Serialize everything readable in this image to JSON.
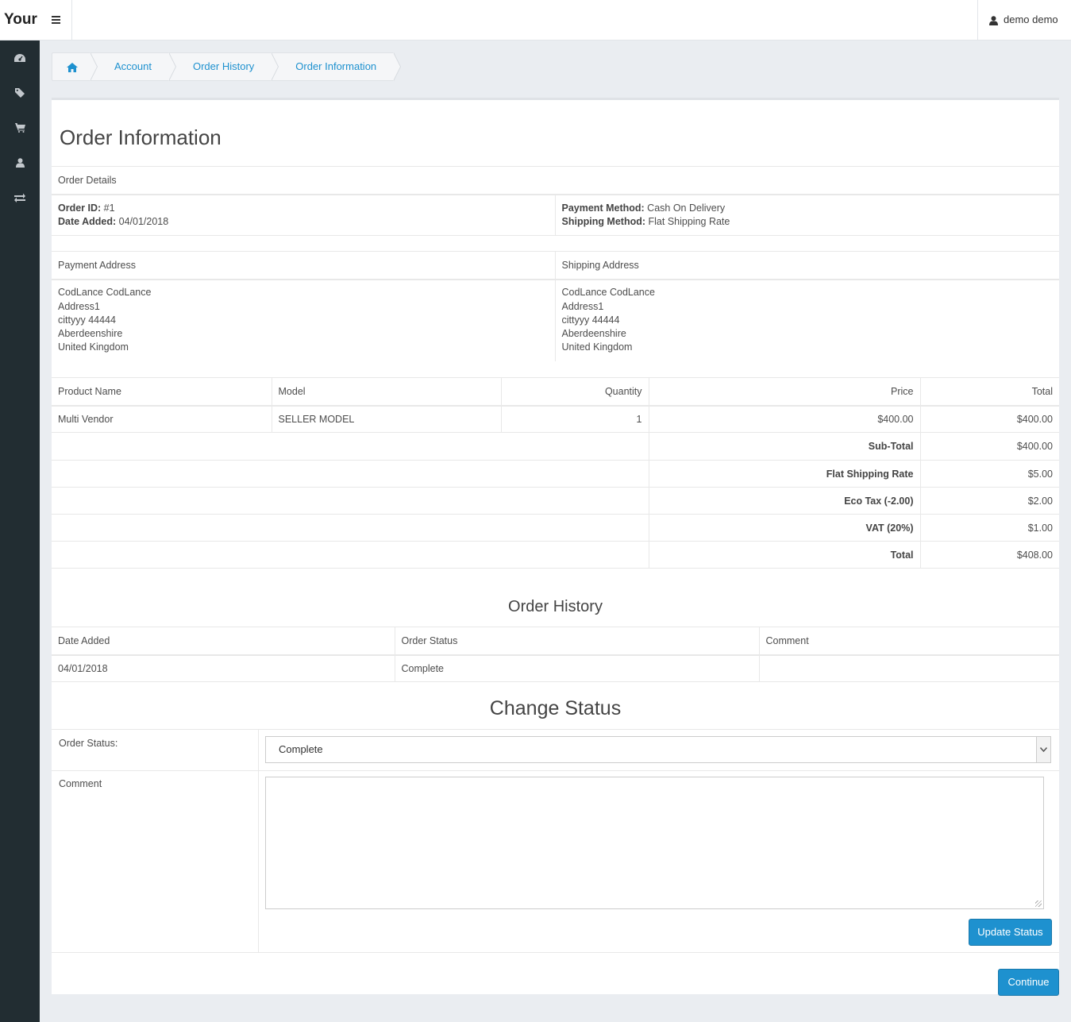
{
  "header": {
    "brand": "Your",
    "menu_icon": "hamburger-icon",
    "user_name": "demo demo",
    "user_icon": "user-icon"
  },
  "sidebar": {
    "items": [
      {
        "icon": "dashboard-icon"
      },
      {
        "icon": "tag-icon"
      },
      {
        "icon": "cart-icon"
      },
      {
        "icon": "user-icon"
      },
      {
        "icon": "exchange-icon"
      }
    ]
  },
  "breadcrumb": {
    "home_icon": "home-icon",
    "items": [
      "Account",
      "Order History",
      "Order Information"
    ]
  },
  "page": {
    "title": "Order Information"
  },
  "order_details": {
    "heading": "Order Details",
    "order_id_label": "Order ID:",
    "order_id": "#1",
    "date_added_label": "Date Added:",
    "date_added": "04/01/2018",
    "payment_method_label": "Payment Method:",
    "payment_method": "Cash On Delivery",
    "shipping_method_label": "Shipping Method:",
    "shipping_method": "Flat Shipping Rate"
  },
  "addresses": {
    "payment_heading": "Payment Address",
    "shipping_heading": "Shipping Address",
    "payment": [
      "CodLance CodLance",
      "Address1",
      "cittyyy 44444",
      "Aberdeenshire",
      "United Kingdom"
    ],
    "shipping": [
      "CodLance CodLance",
      "Address1",
      "cittyyy 44444",
      "Aberdeenshire",
      "United Kingdom"
    ]
  },
  "products": {
    "headers": [
      "Product Name",
      "Model",
      "Quantity",
      "Price",
      "Total"
    ],
    "rows": [
      [
        "Multi Vendor",
        "SELLER MODEL",
        "1",
        "$400.00",
        "$400.00"
      ]
    ],
    "totals": [
      {
        "label": "Sub-Total",
        "value": "$400.00"
      },
      {
        "label": "Flat Shipping Rate",
        "value": "$5.00"
      },
      {
        "label": "Eco Tax (-2.00)",
        "value": "$2.00"
      },
      {
        "label": "VAT (20%)",
        "value": "$1.00"
      },
      {
        "label": "Total",
        "value": "$408.00"
      }
    ]
  },
  "history": {
    "heading": "Order History",
    "headers": [
      "Date Added",
      "Order Status",
      "Comment"
    ],
    "rows": [
      [
        "04/01/2018",
        "Complete",
        ""
      ]
    ]
  },
  "change_status": {
    "heading": "Change Status",
    "status_label": "Order Status:",
    "status_value": "Complete",
    "comment_label": "Comment",
    "update_button": "Update Status"
  },
  "continue_button": "Continue",
  "colors": {
    "accent": "#1e91cf",
    "sidebar": "#222d32",
    "background": "#eaedf1"
  }
}
